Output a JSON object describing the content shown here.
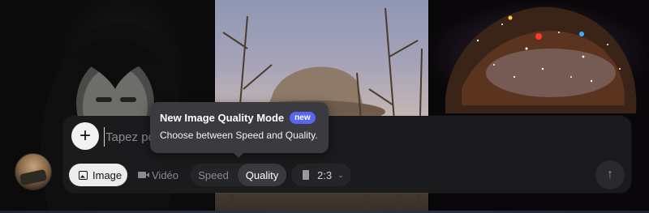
{
  "composer": {
    "add_icon": "+",
    "prompt_placeholder": "Tapez po",
    "modes": {
      "image_label": "Image",
      "video_label": "Vidéo"
    },
    "quality_switch": {
      "speed_label": "Speed",
      "quality_label": "Quality",
      "selected": "Quality"
    },
    "aspect_ratio": {
      "value": "2:3",
      "chevron": "⌄"
    },
    "send_icon": "↑"
  },
  "tooltip": {
    "title": "New Image Quality Mode",
    "badge": "new",
    "description": "Choose between Speed and Quality."
  },
  "colors": {
    "badge_accent": "#5865f2",
    "composer_bg": "#1b1b1d",
    "tooltip_bg": "#3b3b3f"
  },
  "icons": {
    "add": "plus-icon",
    "image": "image-icon",
    "video": "video-camera-icon",
    "ratio": "portrait-ratio-icon",
    "chevron": "chevron-down-icon",
    "send": "arrow-up-icon"
  }
}
